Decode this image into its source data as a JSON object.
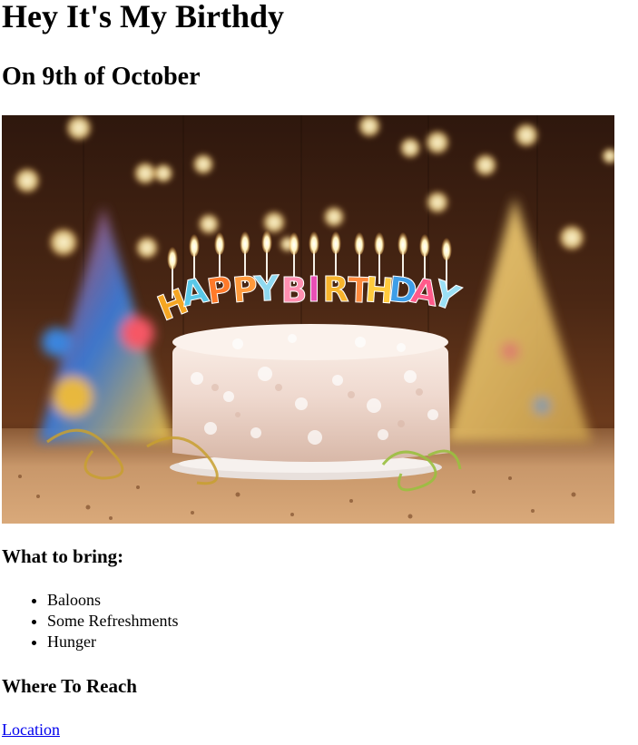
{
  "header": {
    "title": "Hey It's My Birthdy",
    "subtitle": "On 9th of October"
  },
  "hero": {
    "cake_text": "HAPPY BIRTHDAY",
    "letters": [
      "H",
      "A",
      "P",
      "P",
      "Y",
      "B",
      "I",
      "R",
      "T",
      "H",
      "D",
      "A",
      "Y"
    ],
    "letter_colors": [
      "#f5a623",
      "#5ac8e8",
      "#ff7a2a",
      "#ff9a3c",
      "#8fd8f0",
      "#ff8fb0",
      "#e94fb5",
      "#f7b42c",
      "#ff8a3d",
      "#ffcb3d",
      "#3e9ee8",
      "#ff5a8a",
      "#9be0f5"
    ],
    "colors": {
      "background_dark": "#3a1f12",
      "background_warm": "#6b3a1c",
      "frosting": "#f3e4dc",
      "table": "#b9855a",
      "flame": "#fff3c0",
      "bokeh": "#ffe7a0"
    }
  },
  "bring": {
    "heading": "What to bring:",
    "items": [
      "Baloons",
      "Some Refreshments",
      "Hunger"
    ]
  },
  "reach": {
    "heading": "Where To Reach",
    "link_label": "Location"
  }
}
